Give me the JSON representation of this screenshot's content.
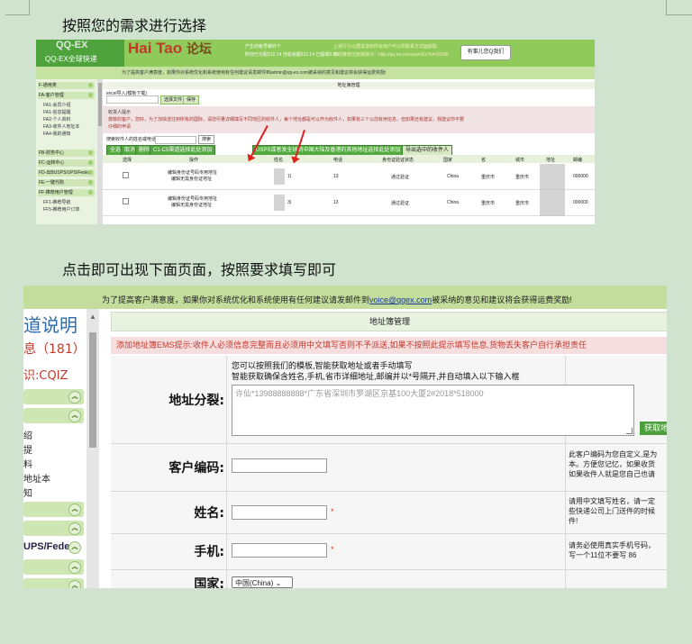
{
  "caption1": "按照您的需求进行选择",
  "caption2": "点击即可出现下面页面，按照要求填写即可",
  "shot1": {
    "logo_big": "QQ-EX",
    "logo_sub": "QQ-EX全球快递",
    "brand_red": "Hai Tao",
    "brand_rest": "论坛",
    "stats": [
      "产生的帐号邮件个",
      "昨日已分配212.14  当前余额212.14  已提现0.00"
    ],
    "stats_right": [
      "上述行为以据发送到所有用户可以所联系方式面获取",
      "您的推荐注册链接为：http://qq-ex.com/user/Ex?id=20186"
    ],
    "qq_btn": "有事儿您Q我们",
    "top_bar": "为了提高客户满意度，如果你对系统优化和系统使用有任何建议请发邮件到admin@qq-ex.com被采纳的意见和建议将会获得运费奖励!",
    "sidebar": {
      "groups": [
        "F-通用类",
        "FA-客户管理",
        "FB-财务中心",
        "FC-运转中心",
        "FD-出BUSPS/UPS/Fedex",
        "FE-一键代购",
        "FF-推荐用户管理"
      ],
      "items": [
        "FA1-会员介绍",
        "FA1-信息提醒",
        "FA2-个人资料",
        "FA3-收件人地址本",
        "FA4-我的通知",
        "FF1-推荐导航",
        "FF5-推荐用户订单"
      ]
    },
    "page_title": "地址簿管理",
    "import_label": "excel导入(模板下载)",
    "select_file": "选择文件",
    "save": "保存",
    "notice": [
      "收货人提示",
      "尊敬的客户，您好，为了加快送往到所有的国际，请您尽量详细填写不同地区的收件人，每个地址都是可以作为收件人，如果有三个以前有用信息，但如果还有建议，我建议你不要",
      "仔细的申请"
    ],
    "search_label": "搜索收件人的姓名或电话",
    "search_btn": "搜索",
    "btn_all": "全选",
    "btn_none": "取消",
    "btn_del": "删除",
    "btn_c1c5": "C1-C5渠道选择此处添加",
    "btn_usps": "USPS或者发全球到中国大陆及香港的其他地址选择此处添加",
    "btn_export": "导出选中的收件人",
    "columns": [
      "选择",
      "操作",
      "姓名",
      "电话",
      "身份证验证状态",
      "国家",
      "省",
      "城市",
      "地址",
      "邮编"
    ],
    "rows": [
      {
        "op1": "编辑身份证号码专用地址",
        "op2": "编辑无需身份证地址",
        "name": "1)",
        "tel": "13",
        "status": "通过验证",
        "country": "China",
        "prov": "重庆市",
        "city": "重庆市",
        "zip": "000000"
      },
      {
        "op1": "编辑身份证号码专用地址",
        "op2": "编辑无需身份证地址",
        "name": "3)",
        "tel": "13",
        "status": "通过验证",
        "country": "China",
        "prov": "重庆市",
        "city": "重庆市",
        "zip": "000000"
      }
    ]
  },
  "shot2": {
    "top_bar_pre": "为了提高客户满意度，如果你对系统优化和系统使用有任何建议请发邮件到",
    "top_bar_mail": "voice@qqex.com",
    "top_bar_post": "被采纳的意见和建议将会获得运费奖励!",
    "left_title": "道说明",
    "left_msg": "息（181）",
    "left_code": "识:CQIZ",
    "left_items": [
      "绍",
      "提",
      "料",
      "地址本",
      "知"
    ],
    "left_group": "UPS/Fedex",
    "page_title": "地址簿管理",
    "notice": "添加地址簿EMS提示:收件人必须信息完整而且必须用中文填写否则不予派送,如果不按照此提示填写信息,货物丢失客户自行承担责任",
    "labels": {
      "split": "地址分裂:",
      "code": "客户编码:",
      "name": "姓名:",
      "phone": "手机:",
      "country": "国家:"
    },
    "split_hint1": "您可以按照我们的模板,智能获取地址或者手动填写",
    "split_hint2": "智能获取确保含姓名,手机,省市详细地址,邮编并以*号隔开,并自动填入以下输入框",
    "split_placeholder": "许仙*13988888888*广东省深圳市罗湖区京基100大厦2#2018*518000",
    "get_address_btn": "获取地址",
    "code_note": [
      "此客户编码为您自定义,是为",
      "本。方便您记忆，如果收货",
      "如果收件人就是您自己也请"
    ],
    "name_note": [
      "请用中文填写姓名，请一定",
      "些快递公司上门送件的时候",
      "件!"
    ],
    "phone_note": [
      "请务必使用真实手机号码，",
      "写一个11位不要写 86"
    ],
    "country_value": "中国(China)",
    "required_mark": "*"
  }
}
